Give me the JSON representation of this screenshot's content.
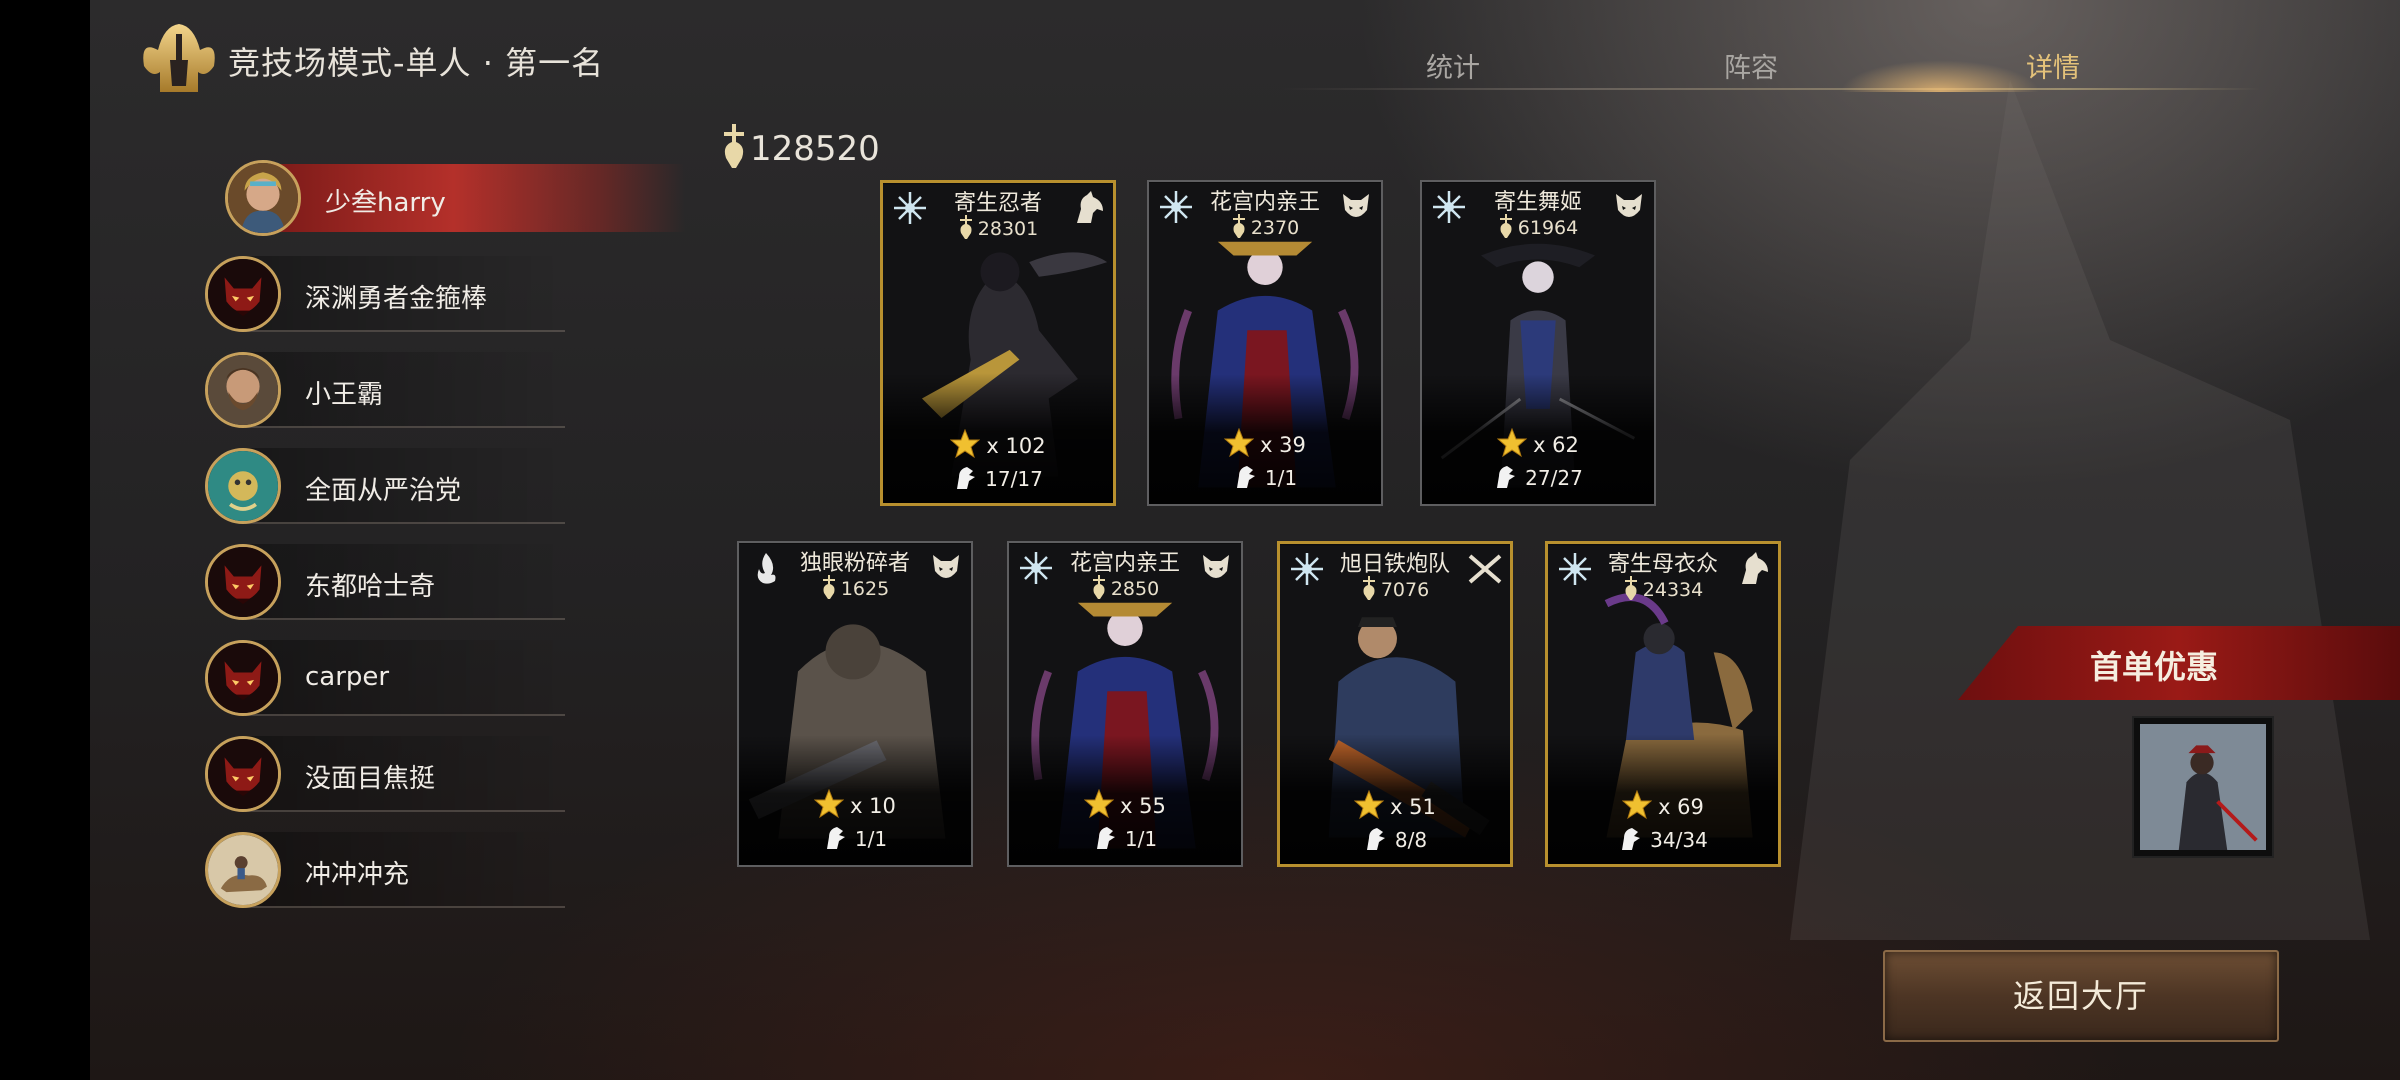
{
  "header": {
    "mode_title": "竞技场模式-单人 · 第一名",
    "tabs": [
      {
        "label": "统计",
        "active": false
      },
      {
        "label": "阵容",
        "active": false
      },
      {
        "label": "详情",
        "active": true
      }
    ]
  },
  "players": [
    {
      "name": "少叁harry",
      "avatar": "female-hero-avatar",
      "active": true
    },
    {
      "name": "深渊勇者金箍棒",
      "avatar": "demon-mask-avatar",
      "active": false
    },
    {
      "name": "小王霸",
      "avatar": "bearded-man-avatar",
      "active": false
    },
    {
      "name": "全面从严治党",
      "avatar": "green-creature-avatar",
      "active": false
    },
    {
      "name": "东都哈士奇",
      "avatar": "demon-mask-avatar",
      "active": false
    },
    {
      "name": "carper",
      "avatar": "demon-mask-avatar",
      "active": false
    },
    {
      "name": "没面目焦挺",
      "avatar": "demon-mask-avatar",
      "active": false
    },
    {
      "name": "冲冲冲充",
      "avatar": "horse-rider-avatar",
      "active": false
    }
  ],
  "total_power": "128520",
  "heroes": [
    {
      "name": "寄生忍者",
      "power": "28301",
      "stars": "x 102",
      "fragments": "17/17",
      "gold": true,
      "class_icon": "star-burst-icon",
      "role_icon": "horse-head-icon"
    },
    {
      "name": "花宫内亲王",
      "power": "2370",
      "stars": "x 39",
      "fragments": "1/1",
      "gold": false,
      "class_icon": "star-burst-icon",
      "role_icon": "mask-crest-icon"
    },
    {
      "name": "寄生舞姬",
      "power": "61964",
      "stars": "x 62",
      "fragments": "27/27",
      "gold": false,
      "class_icon": "star-burst-icon",
      "role_icon": "mask-crest-icon"
    },
    {
      "name": "独眼粉碎者",
      "power": "1625",
      "stars": "x 10",
      "fragments": "1/1",
      "gold": false,
      "class_icon": "flame-icon",
      "role_icon": "mask-crest-icon"
    },
    {
      "name": "花宫内亲王",
      "power": "2850",
      "stars": "x 55",
      "fragments": "1/1",
      "gold": false,
      "class_icon": "star-burst-icon",
      "role_icon": "mask-crest-icon"
    },
    {
      "name": "旭日铁炮队",
      "power": "7076",
      "stars": "x 51",
      "fragments": "8/8",
      "gold": true,
      "class_icon": "star-burst-icon",
      "role_icon": "crossed-guns-icon"
    },
    {
      "name": "寄生母衣众",
      "power": "24334",
      "stars": "x 69",
      "fragments": "34/34",
      "gold": true,
      "class_icon": "star-burst-icon",
      "role_icon": "horse-head-icon"
    }
  ],
  "promo": {
    "label": "首单优惠"
  },
  "back_button": {
    "label": "返回大厅"
  },
  "colors": {
    "accent_gold": "#e4c27a",
    "card_gold_border": "#b8902e",
    "active_player_red": "#b4302a",
    "promo_red": "#8e1414"
  }
}
